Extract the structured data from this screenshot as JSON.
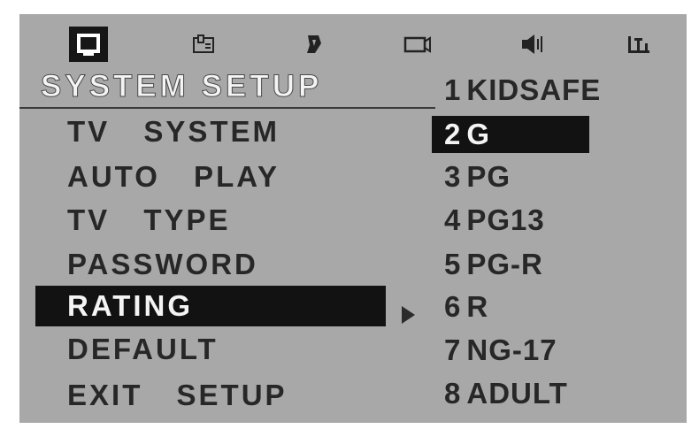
{
  "icons": [
    {
      "name": "tv-icon",
      "selected": true
    },
    {
      "name": "language-icon",
      "selected": false
    },
    {
      "name": "audio-icon",
      "selected": false
    },
    {
      "name": "video-icon",
      "selected": false
    },
    {
      "name": "speaker-icon",
      "selected": false
    },
    {
      "name": "digital-icon",
      "selected": false
    }
  ],
  "heading": "SYSTEM SETUP",
  "menu": {
    "items": [
      {
        "label": "TV SYSTEM"
      },
      {
        "label": "AUTO PLAY"
      },
      {
        "label": "TV TYPE"
      },
      {
        "label": "PASSWORD"
      },
      {
        "label": "RATING",
        "highlighted": true
      },
      {
        "label": "DEFAULT"
      },
      {
        "label": "EXIT SETUP"
      }
    ]
  },
  "options": {
    "items": [
      {
        "num": "1",
        "label": "KIDSAFE"
      },
      {
        "num": "2",
        "label": "G",
        "highlighted": true
      },
      {
        "num": "3",
        "label": "PG"
      },
      {
        "num": "4",
        "label": "PG13"
      },
      {
        "num": "5",
        "label": "PG-R"
      },
      {
        "num": "6",
        "label": "R",
        "current": true
      },
      {
        "num": "7",
        "label": "NG-17"
      },
      {
        "num": "8",
        "label": "ADULT"
      }
    ]
  },
  "colors": {
    "background": "#a8a8a8",
    "highlight": "#121212",
    "text": "#272727",
    "highlight_text": "#f4f4f4"
  }
}
